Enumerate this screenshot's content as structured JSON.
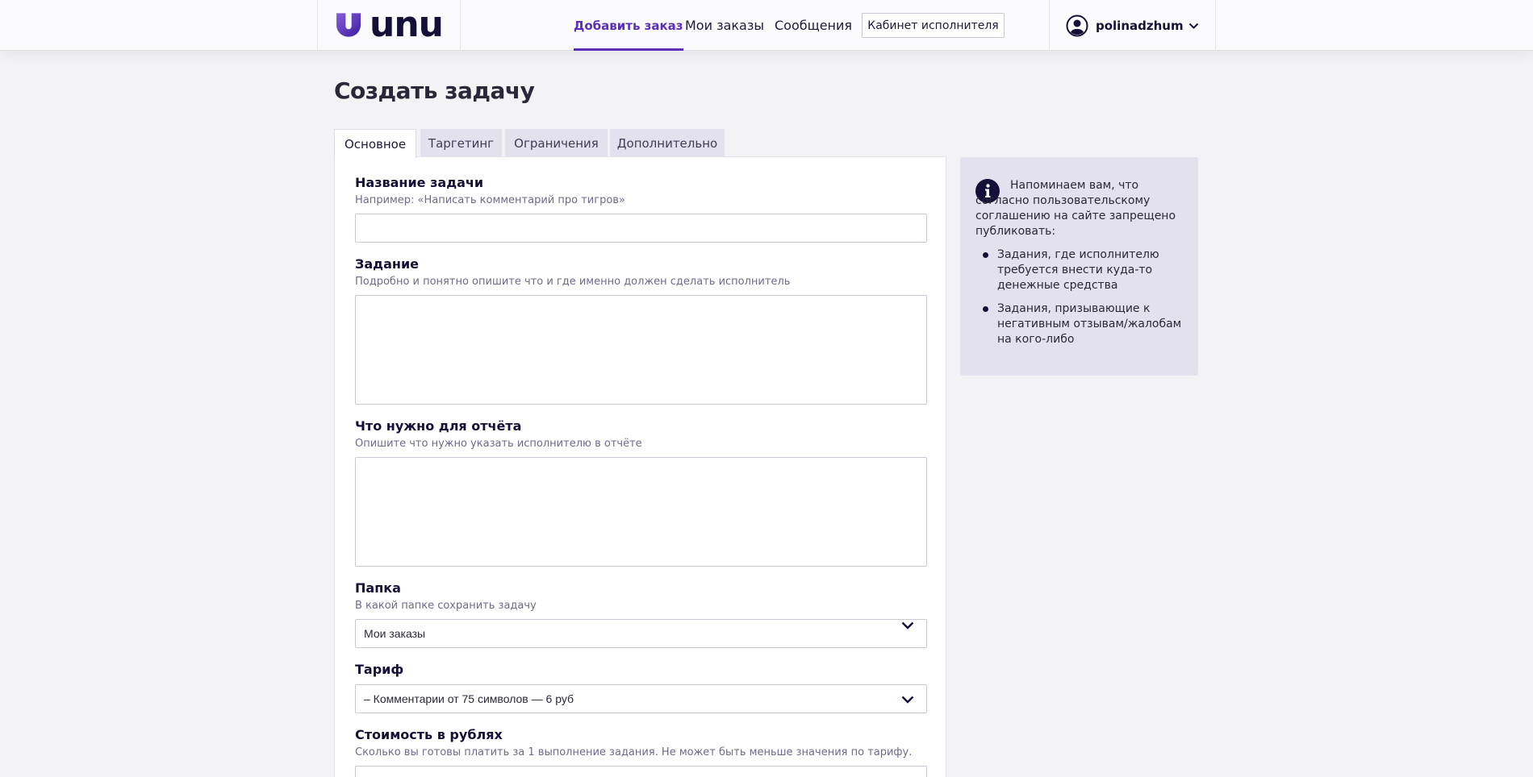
{
  "header": {
    "logo_text": "unu",
    "nav": {
      "add_order": "Добавить заказ",
      "my_orders": "Мои заказы",
      "messages": "Сообщения"
    },
    "cabinet_button": "Кабинет исполнителя",
    "user_name": "polinadzhum"
  },
  "page": {
    "title": "Создать задачу"
  },
  "tabs": {
    "main": "Основное",
    "targeting": "Таргетинг",
    "limits": "Ограничения",
    "extra": "Дополнительно",
    "active": "Основное"
  },
  "form": {
    "task_name": {
      "label": "Название задачи",
      "hint": "Например: «Написать комментарий про тигров»",
      "value": ""
    },
    "task": {
      "label": "Задание",
      "hint": "Подробно и понятно опишите что и где именно должен сделать исполнитель",
      "value": ""
    },
    "report": {
      "label": "Что нужно для отчёта",
      "hint": "Опишите что нужно указать исполнителю в отчёте",
      "value": ""
    },
    "folder": {
      "label": "Папка",
      "hint": "В какой папке сохранить задачу",
      "selected": "Мои заказы"
    },
    "tariff": {
      "label": "Тариф",
      "selected": "– Комментарии от 75 символов — 6 руб"
    },
    "price": {
      "label": "Стоимость в рублях",
      "hint": "Сколько вы готовы платить за 1 выполнение задания. Не может быть меньше значения по тарифу.",
      "value": ""
    }
  },
  "info": {
    "text": "Напоминаем вам, что согласно пользовательскому соглашению на сайте запрещено публиковать:",
    "items": [
      "Задания, где исполнителю требуется внести куда-то денежные средства",
      "Задания, призывающие к негативным отзывам/жалобам на кого-либо"
    ]
  },
  "colors": {
    "accent": "#5b2fb8",
    "background": "#f3f3f6",
    "info_background": "#e3e1ee",
    "text_dark": "#141038"
  },
  "icons": {
    "logo": "unu-logo-mark",
    "user": "user-avatar-icon",
    "info": "info-icon",
    "chevron": "chevron-down-icon"
  }
}
